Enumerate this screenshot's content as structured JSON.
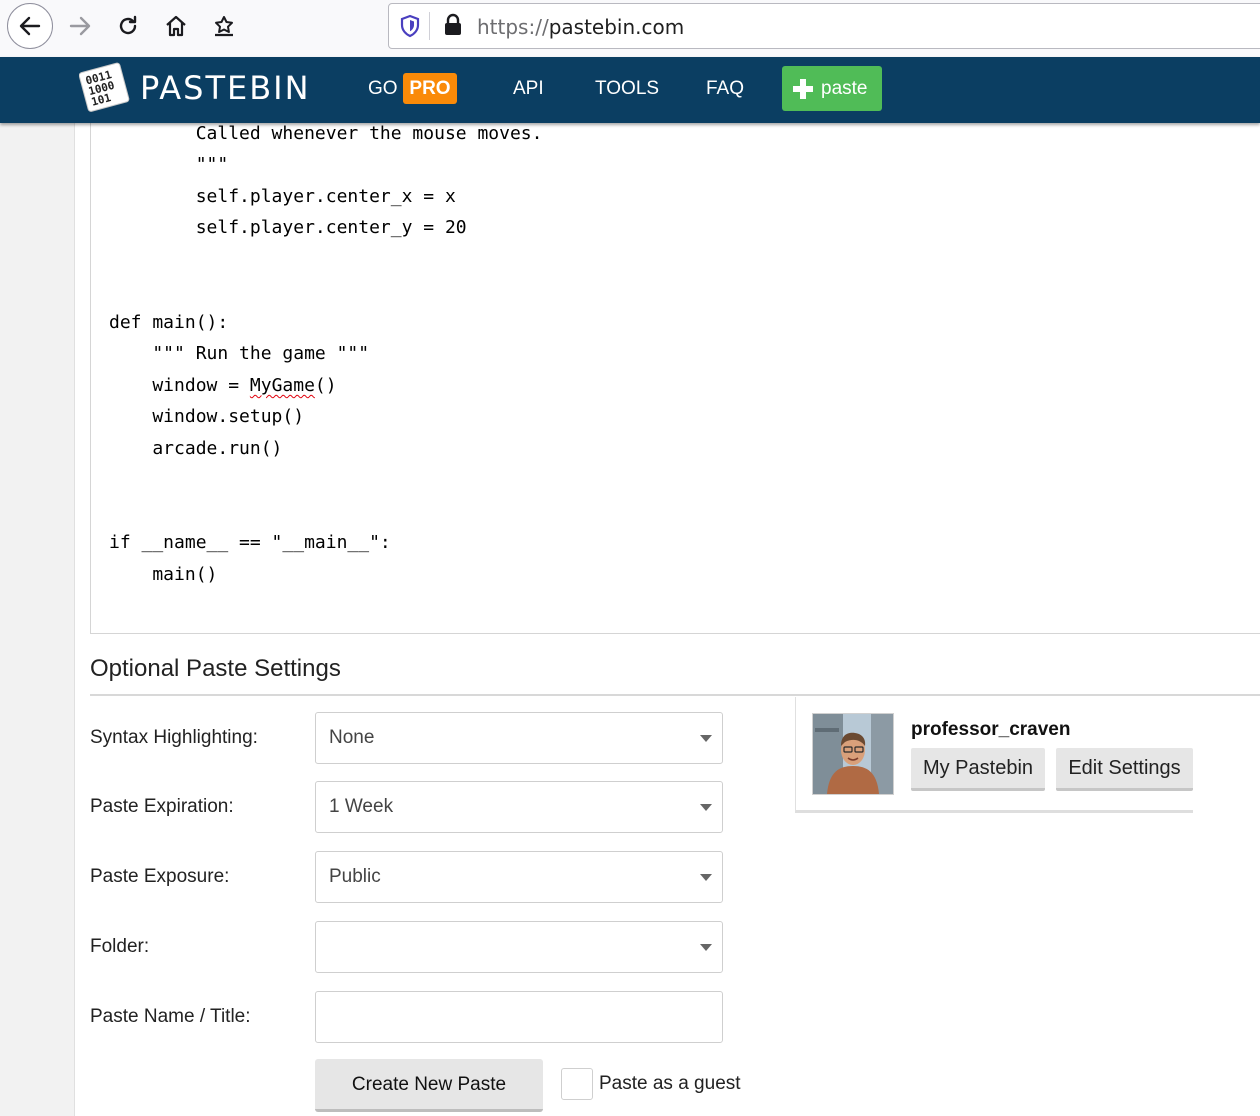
{
  "browser": {
    "url_protocol": "https://",
    "url_host": "pastebin.com"
  },
  "header": {
    "brand": "PASTEBIN",
    "logo_text": [
      "0011",
      "1000",
      "101"
    ],
    "nav": {
      "go": "GO",
      "pro": "PRO",
      "api": "API",
      "tools": "TOOLS",
      "faq": "FAQ",
      "paste": "paste"
    },
    "colors": {
      "bar": "#0b3e62",
      "pro": "#fa8a08",
      "paste": "#50bc57"
    }
  },
  "code": {
    "lines": [
      "        Called whenever the mouse moves.",
      "        \"\"\"",
      "        self.player.center_x = x",
      "        self.player.center_y = 20",
      "",
      "",
      "def main():",
      "    \"\"\" Run the game \"\"\"",
      "    window = MyGame()",
      "    window.setup()",
      "    arcade.run()",
      "",
      "",
      "if __name__ == \"__main__\":",
      "    main()"
    ],
    "misspelled_word": "MyGame"
  },
  "settings": {
    "title": "Optional Paste Settings",
    "syntax_label": "Syntax Highlighting:",
    "syntax_value": "None",
    "expiration_label": "Paste Expiration:",
    "expiration_value": "1 Week",
    "exposure_label": "Paste Exposure:",
    "exposure_value": "Public",
    "folder_label": "Folder:",
    "folder_value": "",
    "title_label": "Paste Name / Title:",
    "title_value": "",
    "create_button": "Create New Paste",
    "guest_label": "Paste as a guest"
  },
  "user": {
    "username": "professor_craven",
    "my_pastebin": "My Pastebin",
    "edit_settings": "Edit Settings"
  }
}
